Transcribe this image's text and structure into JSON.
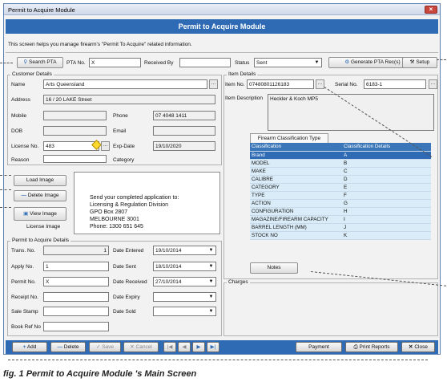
{
  "window": {
    "title": "Permit to Acquire Module",
    "close": "×"
  },
  "banner": {
    "title": "Permit to Acquire Module"
  },
  "help_text": "This screen helps you manage firearm's \"Permit To Acquire\" related information.",
  "search_bar": {
    "search_button": "Search PTA",
    "pta_no_label": "PTA No.",
    "pta_no_value": "X",
    "received_by_label": "Received By",
    "received_by_value": "",
    "status_label": "Status",
    "status_value": "Sent",
    "generate_button": "Generate PTA Rec(s)",
    "setup_button": "Setup"
  },
  "customer": {
    "group_title": "Customer Details",
    "name_label": "Name",
    "name_value": "Arts Queensland",
    "address_label": "Address",
    "address_value": "16 / 20 LAKE Street",
    "mobile_label": "Mobile",
    "mobile_value": "",
    "phone_label": "Phone",
    "phone_value": "07 4048 1411",
    "dob_label": "DOB",
    "dob_value": "",
    "email_label": "Email",
    "email_value": "",
    "license_label": "License No.",
    "license_value": "483",
    "exp_label": "Exp-Date",
    "exp_value": "19/10/2020",
    "reason_label": "Reason",
    "reason_value": "",
    "category_label": "Category",
    "category_value": ""
  },
  "image_panel": {
    "load": "Load Image",
    "delete": "Delete Image",
    "view": "View Image",
    "caption": "License Image",
    "text_lines": [
      "Send your completed application to:",
      "Licensing & Regulation Division",
      "GPO Box 2807",
      "MELBOURNE 3001",
      "Phone: 1300 651 645"
    ]
  },
  "pta_details": {
    "group_title": "Permit to Acquire Details",
    "trans_label": "Trans. No.",
    "trans_value": "1",
    "apply_label": "Apply No.",
    "apply_value": "1",
    "permit_label": "Permit No.",
    "permit_value": "X",
    "receipt_label": "Receipt No.",
    "receipt_value": "",
    "sale_label": "Sale Stamp",
    "sale_value": "",
    "bookref_label": "Book Ref No",
    "bookref_value": "",
    "entered_label": "Date Entered",
    "entered_value": "19/10/2014",
    "sent_label": "Date Sent",
    "sent_value": "18/10/2014",
    "received_label": "Date Received",
    "received_value": "27/10/2014",
    "expiry_label": "Date Expiry",
    "expiry_value": "",
    "sold_label": "Date Sold",
    "sold_value": ""
  },
  "item": {
    "group_title": "Item Details",
    "item_no_label": "Item No.",
    "item_no_value": "07480801126183",
    "serial_label": "Serial No.",
    "serial_value": "6183-1",
    "desc_label": "Item Description",
    "desc_value": "Heckler & Koch MP5",
    "tab_label": "Firearm Classification Type",
    "grid_headers": [
      "Classification",
      "Classification Details"
    ],
    "grid_rows": [
      [
        "Brand",
        "A"
      ],
      [
        "MODEL",
        "B"
      ],
      [
        "MAKE",
        "C"
      ],
      [
        "CALIBRE",
        "D"
      ],
      [
        "CATEGORY",
        "E"
      ],
      [
        "TYPE",
        "F"
      ],
      [
        "ACTION",
        "G"
      ],
      [
        "CONFIGURATION",
        "H"
      ],
      [
        "MAGAZINE/FIREARM CAPACITY",
        "I"
      ],
      [
        "BARREL LENGTH (MM)",
        "J"
      ],
      [
        "STOCK NO",
        "K"
      ]
    ],
    "notes_button": "Notes",
    "charges_title": "Charges"
  },
  "toolbar": {
    "add": "Add",
    "delete": "Delete",
    "save": "Save",
    "cancel": "Cancel",
    "payment": "Payment",
    "print": "Print Reports",
    "close": "Close"
  },
  "caption": "fig. 1 Permit to Acquire Module 's Main Screen",
  "colors": {
    "accent": "#2f6bb5",
    "grid_row": "#d9ecf7"
  }
}
